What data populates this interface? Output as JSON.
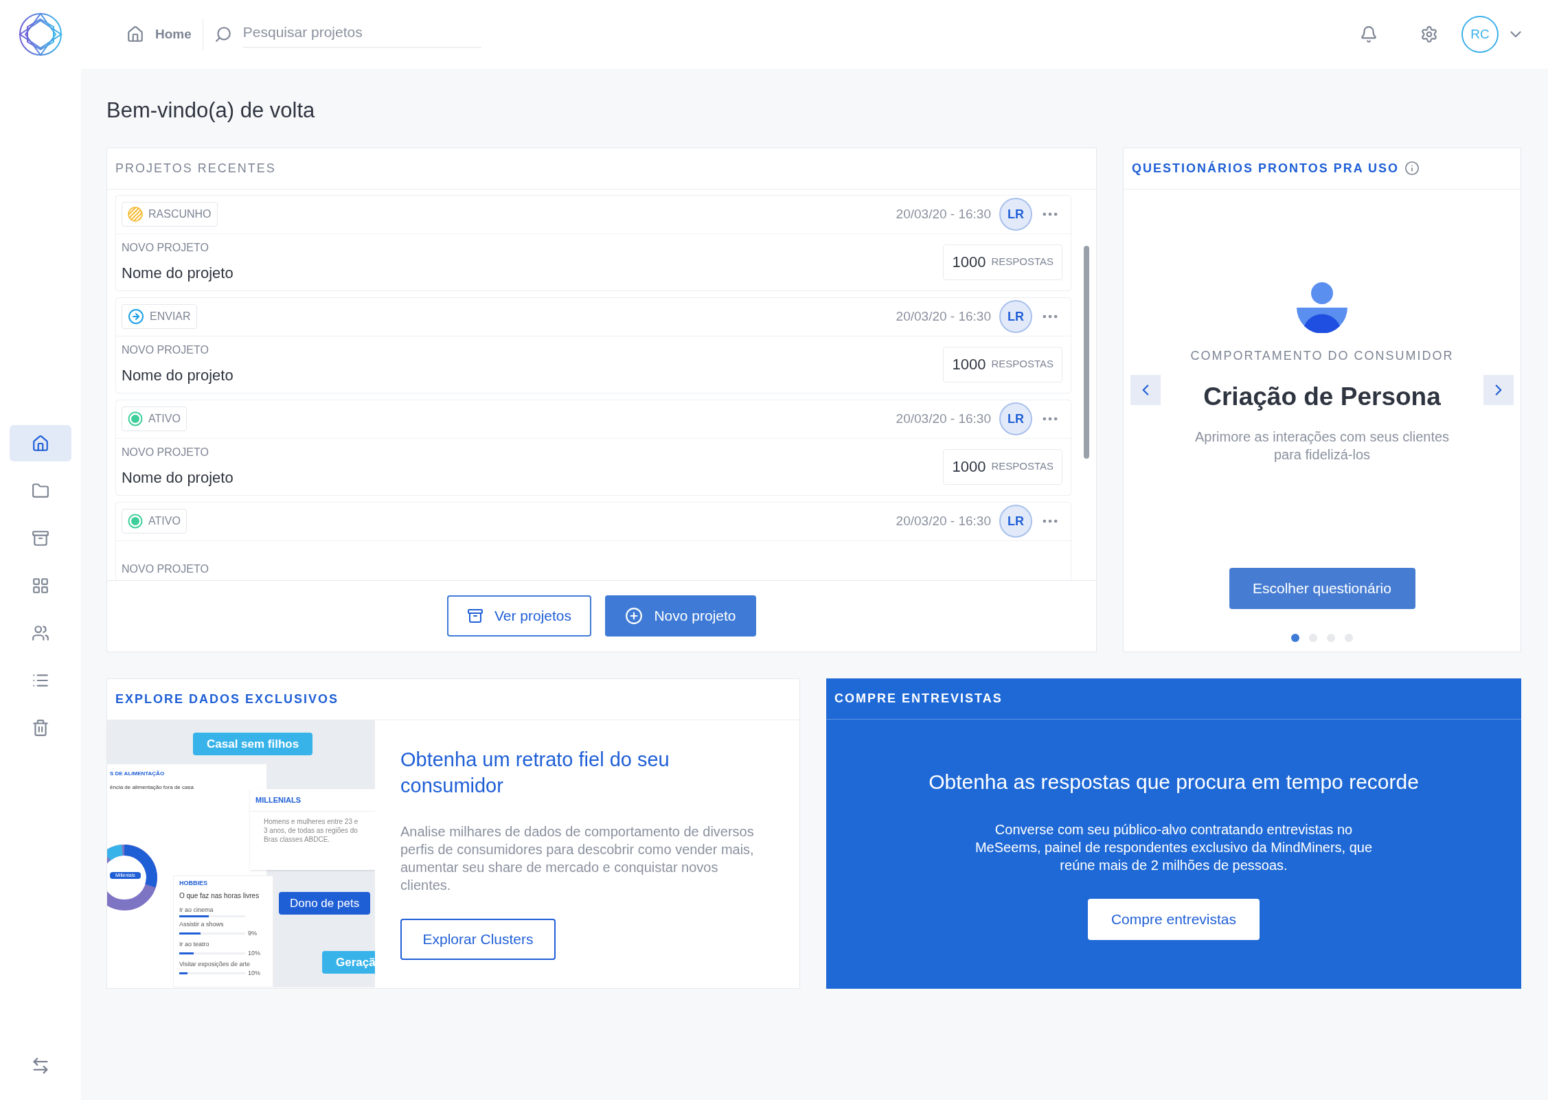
{
  "topbar": {
    "home": "Home",
    "search": {
      "placeholder": "Pesquisar projetos"
    },
    "user_initials": "RC"
  },
  "sidebar": {
    "items": [
      {
        "selected": true
      },
      {
        "selected": false
      },
      {
        "selected": false
      },
      {
        "selected": false
      },
      {
        "selected": false
      },
      {
        "selected": false
      },
      {
        "selected": false
      }
    ]
  },
  "title": "Bem-vindo(a) de volta",
  "recent_projects": {
    "heading": "PROJETOS RECENTES",
    "items": [
      {
        "status": {
          "kind": "draft",
          "label": "RASCUNHO"
        },
        "date": "20/03/20 - 16:30",
        "owner": "LR",
        "type": "NOVO PROJETO",
        "name": "Nome do projeto",
        "responses": "1000",
        "responses_label": "RESPOSTAS"
      },
      {
        "status": {
          "kind": "send",
          "label": "ENVIAR"
        },
        "date": "20/03/20 - 16:30",
        "owner": "LR",
        "type": "NOVO PROJETO",
        "name": "Nome do projeto",
        "responses": "1000",
        "responses_label": "RESPOSTAS"
      },
      {
        "status": {
          "kind": "active",
          "label": "ATIVO"
        },
        "date": "20/03/20 - 16:30",
        "owner": "LR",
        "type": "NOVO PROJETO",
        "name": "Nome do projeto",
        "responses": "1000",
        "responses_label": "RESPOSTAS"
      },
      {
        "status": {
          "kind": "active",
          "label": "ATIVO"
        },
        "date": "20/03/20 - 16:30",
        "owner": "LR",
        "type": "NOVO PROJETO"
      }
    ],
    "buttons": {
      "view": "Ver projetos",
      "new": "Novo projeto"
    }
  },
  "questionnaires": {
    "heading": "QUESTIONÁRIOS PRONTOS PRA USO",
    "category": "COMPORTAMENTO DO CONSUMIDOR",
    "title": "Criação de Persona",
    "description": "Aprimore as interações com seus clientes para fidelizá-los",
    "button": "Escolher questionário",
    "dots": [
      {
        "selected": true
      },
      {
        "selected": false
      },
      {
        "selected": false
      },
      {
        "selected": false
      }
    ]
  },
  "explore": {
    "heading": "EXPLORE DADOS EXCLUSIVOS",
    "illustration": {
      "tag_1": "Casal sem filhos",
      "panel_title": "S DE ALIMENTAÇÃO",
      "panel_question": "ência de alimentação fora de casa",
      "donut_label": "Millenials",
      "persona_title": "MILLENIALS",
      "persona_text": "Homens e mulheres entre 23 e 3 anos, de todas as regiões do Bras classes ABDCE.",
      "hobbies_title": "HOBBIES",
      "hobbies_question": "O que faz nas horas livres",
      "hobbies": [
        {
          "label": "Ir ao cinema",
          "level": 0.45
        },
        {
          "label": "Assistir a shows",
          "level": 0.32,
          "change": "9%"
        },
        {
          "label": "Ir ao teatro",
          "level": 0.22,
          "change": "10%"
        },
        {
          "label": "Visitar exposições de arte",
          "level": 0.13,
          "change": "10%"
        }
      ],
      "tag_2": "Dono de pets",
      "tag_3": "Geraçã"
    },
    "title": "Obtenha um retrato fiel do seu consumidor",
    "text": "Analise milhares de dados de comportamento de diversos perfis de consumidores para descobrir como vender mais, aumentar seu share de mercado e conquistar novos clientes.",
    "button": "Explorar Clusters"
  },
  "interviews": {
    "heading": "COMPRE ENTREVISTAS",
    "title": "Obtenha as respostas que procura em tempo recorde",
    "text": "Converse com seu público-alvo contratando entrevistas no MeSeems,  painel de respondentes exclusivo da MindMiners, que reúne mais de 2 milhões de pessoas.",
    "button": "Compre entrevistas"
  }
}
